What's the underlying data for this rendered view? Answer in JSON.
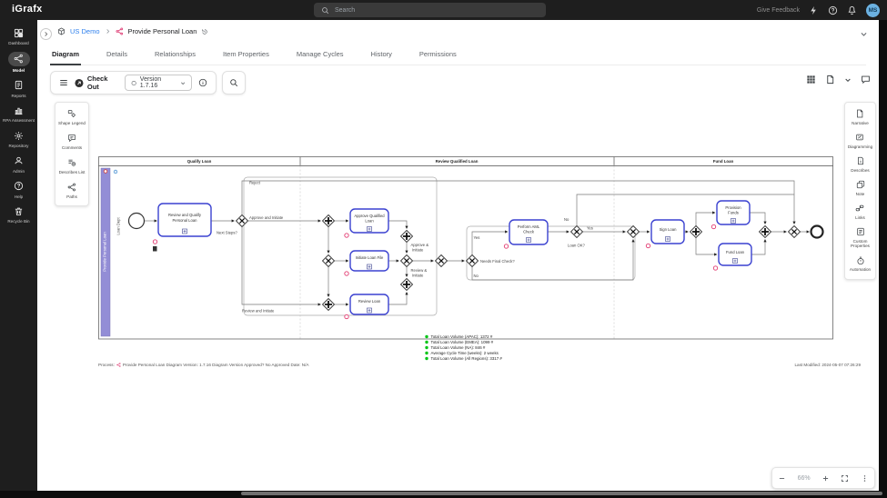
{
  "colors": {
    "topbar_bg": "#1e1e1e",
    "link_blue": "#2f80ed",
    "pink": "#e0457b",
    "task_border": "#3a41d0",
    "pool_purple": "#938dd6",
    "legend_green": "#00c516",
    "avatar_blue": "#6cb2e2"
  },
  "topbar": {
    "logo": "iGrafx",
    "search_placeholder": "Search",
    "give_feedback": "Give Feedback",
    "avatar_initials": "MS"
  },
  "nav": {
    "items": [
      "Dashboard",
      "Model",
      "Reports",
      "RPA Assessment",
      "Repository",
      "Admin",
      "Help",
      "Recycle Bin"
    ],
    "active": "Model"
  },
  "breadcrumb": {
    "project": "US Demo",
    "item": "Provide Personal Loan"
  },
  "tabs": {
    "items": [
      "Diagram",
      "Details",
      "Relationships",
      "Item Properties",
      "Manage Cycles",
      "History",
      "Permissions"
    ],
    "active": "Diagram"
  },
  "toolbar": {
    "check_out": "Check Out",
    "version": "Version 1.7.16"
  },
  "left_panel": {
    "items": [
      "Shape Legend",
      "Comments",
      "Describes List",
      "Paths"
    ]
  },
  "right_panel": {
    "items": [
      "Narrative",
      "Diagramming",
      "Describes",
      "Note",
      "Links",
      "Custom Properties",
      "Automation"
    ]
  },
  "diagram": {
    "phases": [
      "Qualify Loan",
      "Review Qualified Loan",
      "Fund Loan"
    ],
    "pool": "Provide Personal Loan",
    "lane": "Loan Dept",
    "nodes": {
      "review_qualify": {
        "l1": "Review and Qualify",
        "l2": "Personal Loan"
      },
      "approve_qualified": {
        "l1": "Approve Qualified",
        "l2": "Loan"
      },
      "initiate_loan_file": {
        "l1": "Initiate Loan File"
      },
      "review_loan": {
        "l1": "Review Loan"
      },
      "perform_aml": {
        "l1": "Perform AML",
        "l2": "Check"
      },
      "sign_loan": {
        "l1": "Sign Loan"
      },
      "provision_funds": {
        "l1": "Provision",
        "l2": "Funds"
      },
      "fund_loan": {
        "l1": "Fund Loan"
      }
    },
    "labels": {
      "reject": "Reject",
      "approve_and_initiate": "Approve and Initiate",
      "review_and_initiate": "Review and Initiate",
      "next_steps": "Next Steps?",
      "approve_amp": "Approve &",
      "review_amp": "Review &",
      "initiate": "Initiate",
      "needs_final_check": "Needs Final Check?",
      "yes": "Yes",
      "no": "No",
      "loan_ok": "Loan OK?"
    },
    "legend": [
      "Total Loan Volume (APAC): 1372 #",
      "Total Loan Volume (EMEA): 1099 #",
      "Total Loan Volume (NA): 846 #",
      "Average Cycle Time (weeks): 2 weeks",
      "Total Loan Volume (All Regions): 3317 #"
    ],
    "status_left_prefix": "Process:",
    "status_left": "Provide Personal Loan Diagram Version: 1.7.16 Diagram Version Approved? No Approved Date: N/A",
    "status_right": "Last Modified: 2024-05-07 07:26:29"
  },
  "zoom_controls": {
    "level": "66%"
  }
}
